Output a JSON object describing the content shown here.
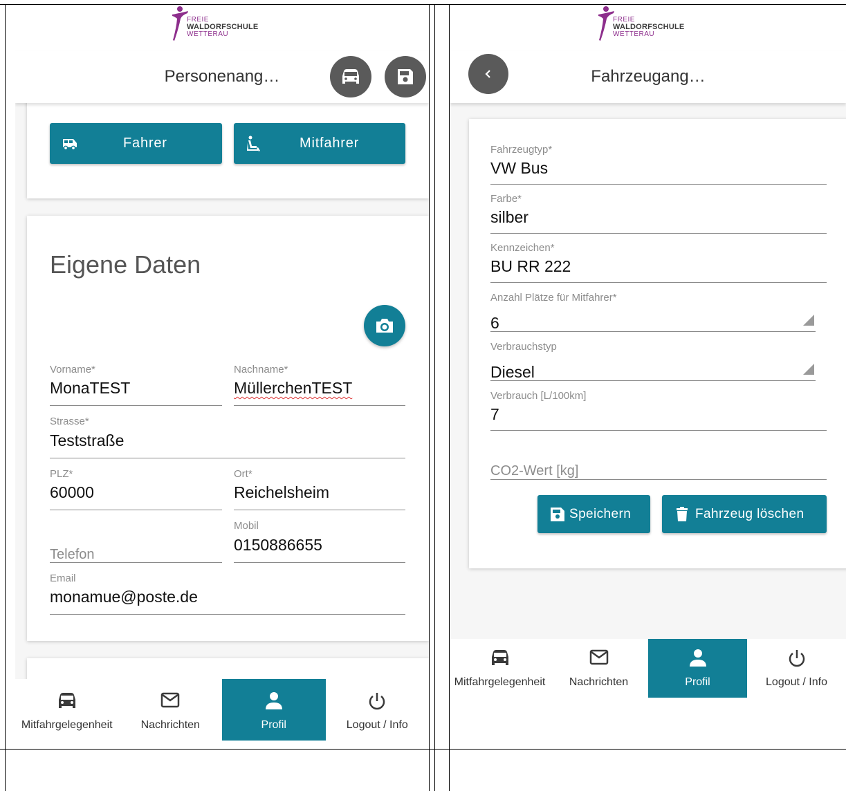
{
  "logo": {
    "line1": "FREIE",
    "line2": "WALDORFSCHULE",
    "line3": "WETTERAU"
  },
  "left": {
    "title": "Personenang…",
    "role_buttons": {
      "driver": "Fahrer",
      "passenger": "Mitfahrer"
    },
    "section_title": "Eigene Daten",
    "fields": {
      "vorname": {
        "label": "Vorname*",
        "value": "MonaTEST"
      },
      "nachname": {
        "label": "Nachname*",
        "value": "MüllerchenTEST"
      },
      "strasse": {
        "label": "Strasse*",
        "value": "Teststraße"
      },
      "plz": {
        "label": "PLZ*",
        "value": "60000"
      },
      "ort": {
        "label": "Ort*",
        "value": "Reichelsheim"
      },
      "telefon": {
        "placeholder": "Telefon"
      },
      "mobil": {
        "label": "Mobil",
        "value": "0150886655"
      },
      "email": {
        "label": "Email",
        "value": "monamue@poste.de"
      }
    }
  },
  "right": {
    "title": "Fahrzeugang…",
    "fields": {
      "fahrzeugtyp": {
        "label": "Fahrzeugtyp*",
        "value": "VW Bus"
      },
      "farbe": {
        "label": "Farbe*",
        "value": "silber"
      },
      "kennzeichen": {
        "label": "Kennzeichen*",
        "value": "BU RR 222"
      },
      "plaetze": {
        "label": "Anzahl Plätze für Mitfahrer*",
        "value": "6"
      },
      "verbrauchstyp": {
        "label": "Verbrauchstyp",
        "value": "Diesel"
      },
      "verbrauch": {
        "label": "Verbrauch [L/100km]",
        "value": "7"
      },
      "co2": {
        "placeholder": "CO2-Wert [kg]"
      }
    },
    "save_label": "Speichern",
    "delete_label": "Fahrzeug löschen"
  },
  "nav": {
    "items": [
      {
        "label": "Mitfahrgelegenheit",
        "icon": "car-icon"
      },
      {
        "label": "Nachrichten",
        "icon": "mail-icon"
      },
      {
        "label": "Profil",
        "icon": "person-icon"
      },
      {
        "label": "Logout / Info",
        "icon": "power-icon"
      }
    ],
    "active": "Profil"
  },
  "colors": {
    "accent": "#127f96",
    "brand": "#8d2e8c",
    "round_button": "#5a5a5a"
  }
}
